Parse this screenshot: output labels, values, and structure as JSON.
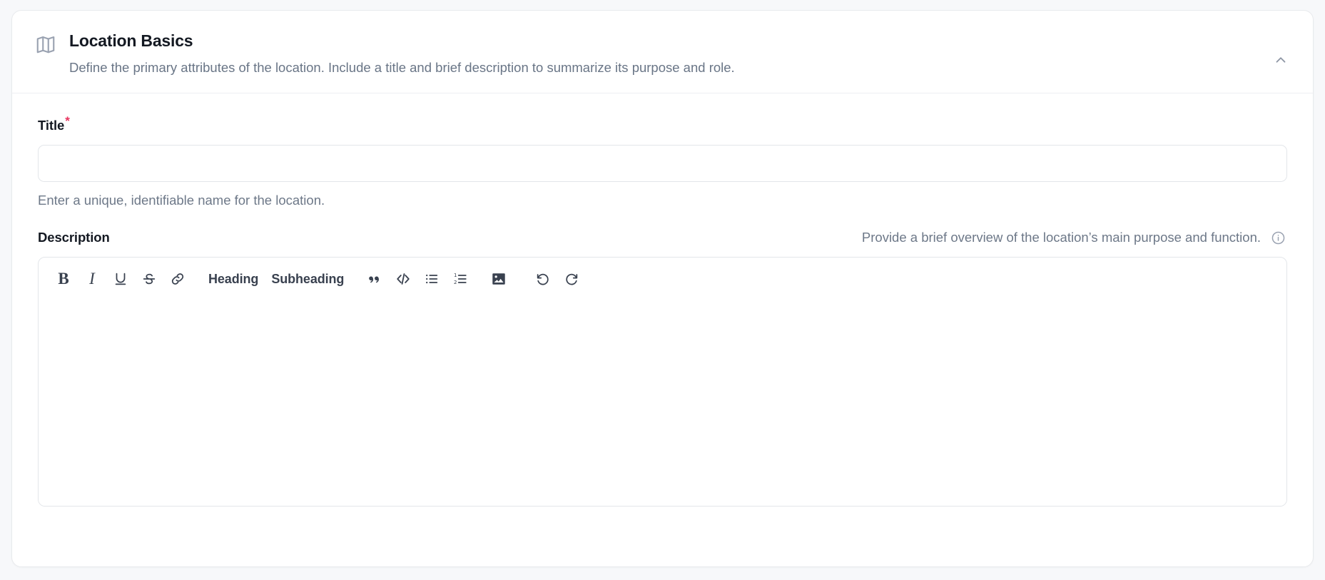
{
  "page": {
    "background_color": "#f7f8fa"
  },
  "card": {
    "icon": "map-icon",
    "title": "Location Basics",
    "subtitle": "Define the primary attributes of the location. Include a title and brief description to summarize its purpose and role.",
    "collapse_icon": "chevron-up-icon",
    "collapsed": false,
    "accent_required_color": "#e8355f",
    "border_color": "#e8eaed"
  },
  "title_field": {
    "label": "Title",
    "required_marker": "*",
    "required": true,
    "value": "",
    "placeholder": "",
    "help_text": "Enter a unique, identifiable name for the location."
  },
  "description_field": {
    "label": "Description",
    "hint": "Provide a brief overview of the location’s main purpose and function.",
    "info_icon": "info-icon",
    "value": "",
    "placeholder": ""
  },
  "editor_toolbar": {
    "buttons": [
      {
        "name": "bold-button",
        "icon": "bold-icon",
        "label": "B",
        "type": "glyph-serif-bold"
      },
      {
        "name": "italic-button",
        "icon": "italic-icon",
        "label": "I",
        "type": "glyph-serif-italic"
      },
      {
        "name": "underline-button",
        "icon": "underline-icon",
        "label": "U",
        "type": "svg"
      },
      {
        "name": "strikethrough-button",
        "icon": "strikethrough-icon",
        "label": "S",
        "type": "svg"
      },
      {
        "name": "link-button",
        "icon": "link-icon",
        "label": "Link",
        "type": "svg"
      },
      {
        "name": "heading-button",
        "icon": "heading-icon",
        "label": "Heading",
        "type": "text"
      },
      {
        "name": "subheading-button",
        "icon": "subheading-icon",
        "label": "Subheading",
        "type": "text"
      },
      {
        "name": "blockquote-button",
        "icon": "quote-icon",
        "label": "“",
        "type": "svg"
      },
      {
        "name": "code-block-button",
        "icon": "code-icon",
        "label": "</>",
        "type": "svg"
      },
      {
        "name": "bullet-list-button",
        "icon": "bullet-list-icon",
        "label": "Bullet list",
        "type": "svg"
      },
      {
        "name": "numbered-list-button",
        "icon": "numbered-list-icon",
        "label": "Numbered list",
        "type": "svg"
      },
      {
        "name": "insert-image-button",
        "icon": "image-icon",
        "label": "Image",
        "type": "svg"
      },
      {
        "name": "undo-button",
        "icon": "undo-icon",
        "label": "Undo",
        "type": "svg"
      },
      {
        "name": "redo-button",
        "icon": "redo-icon",
        "label": "Redo",
        "type": "svg"
      }
    ]
  }
}
